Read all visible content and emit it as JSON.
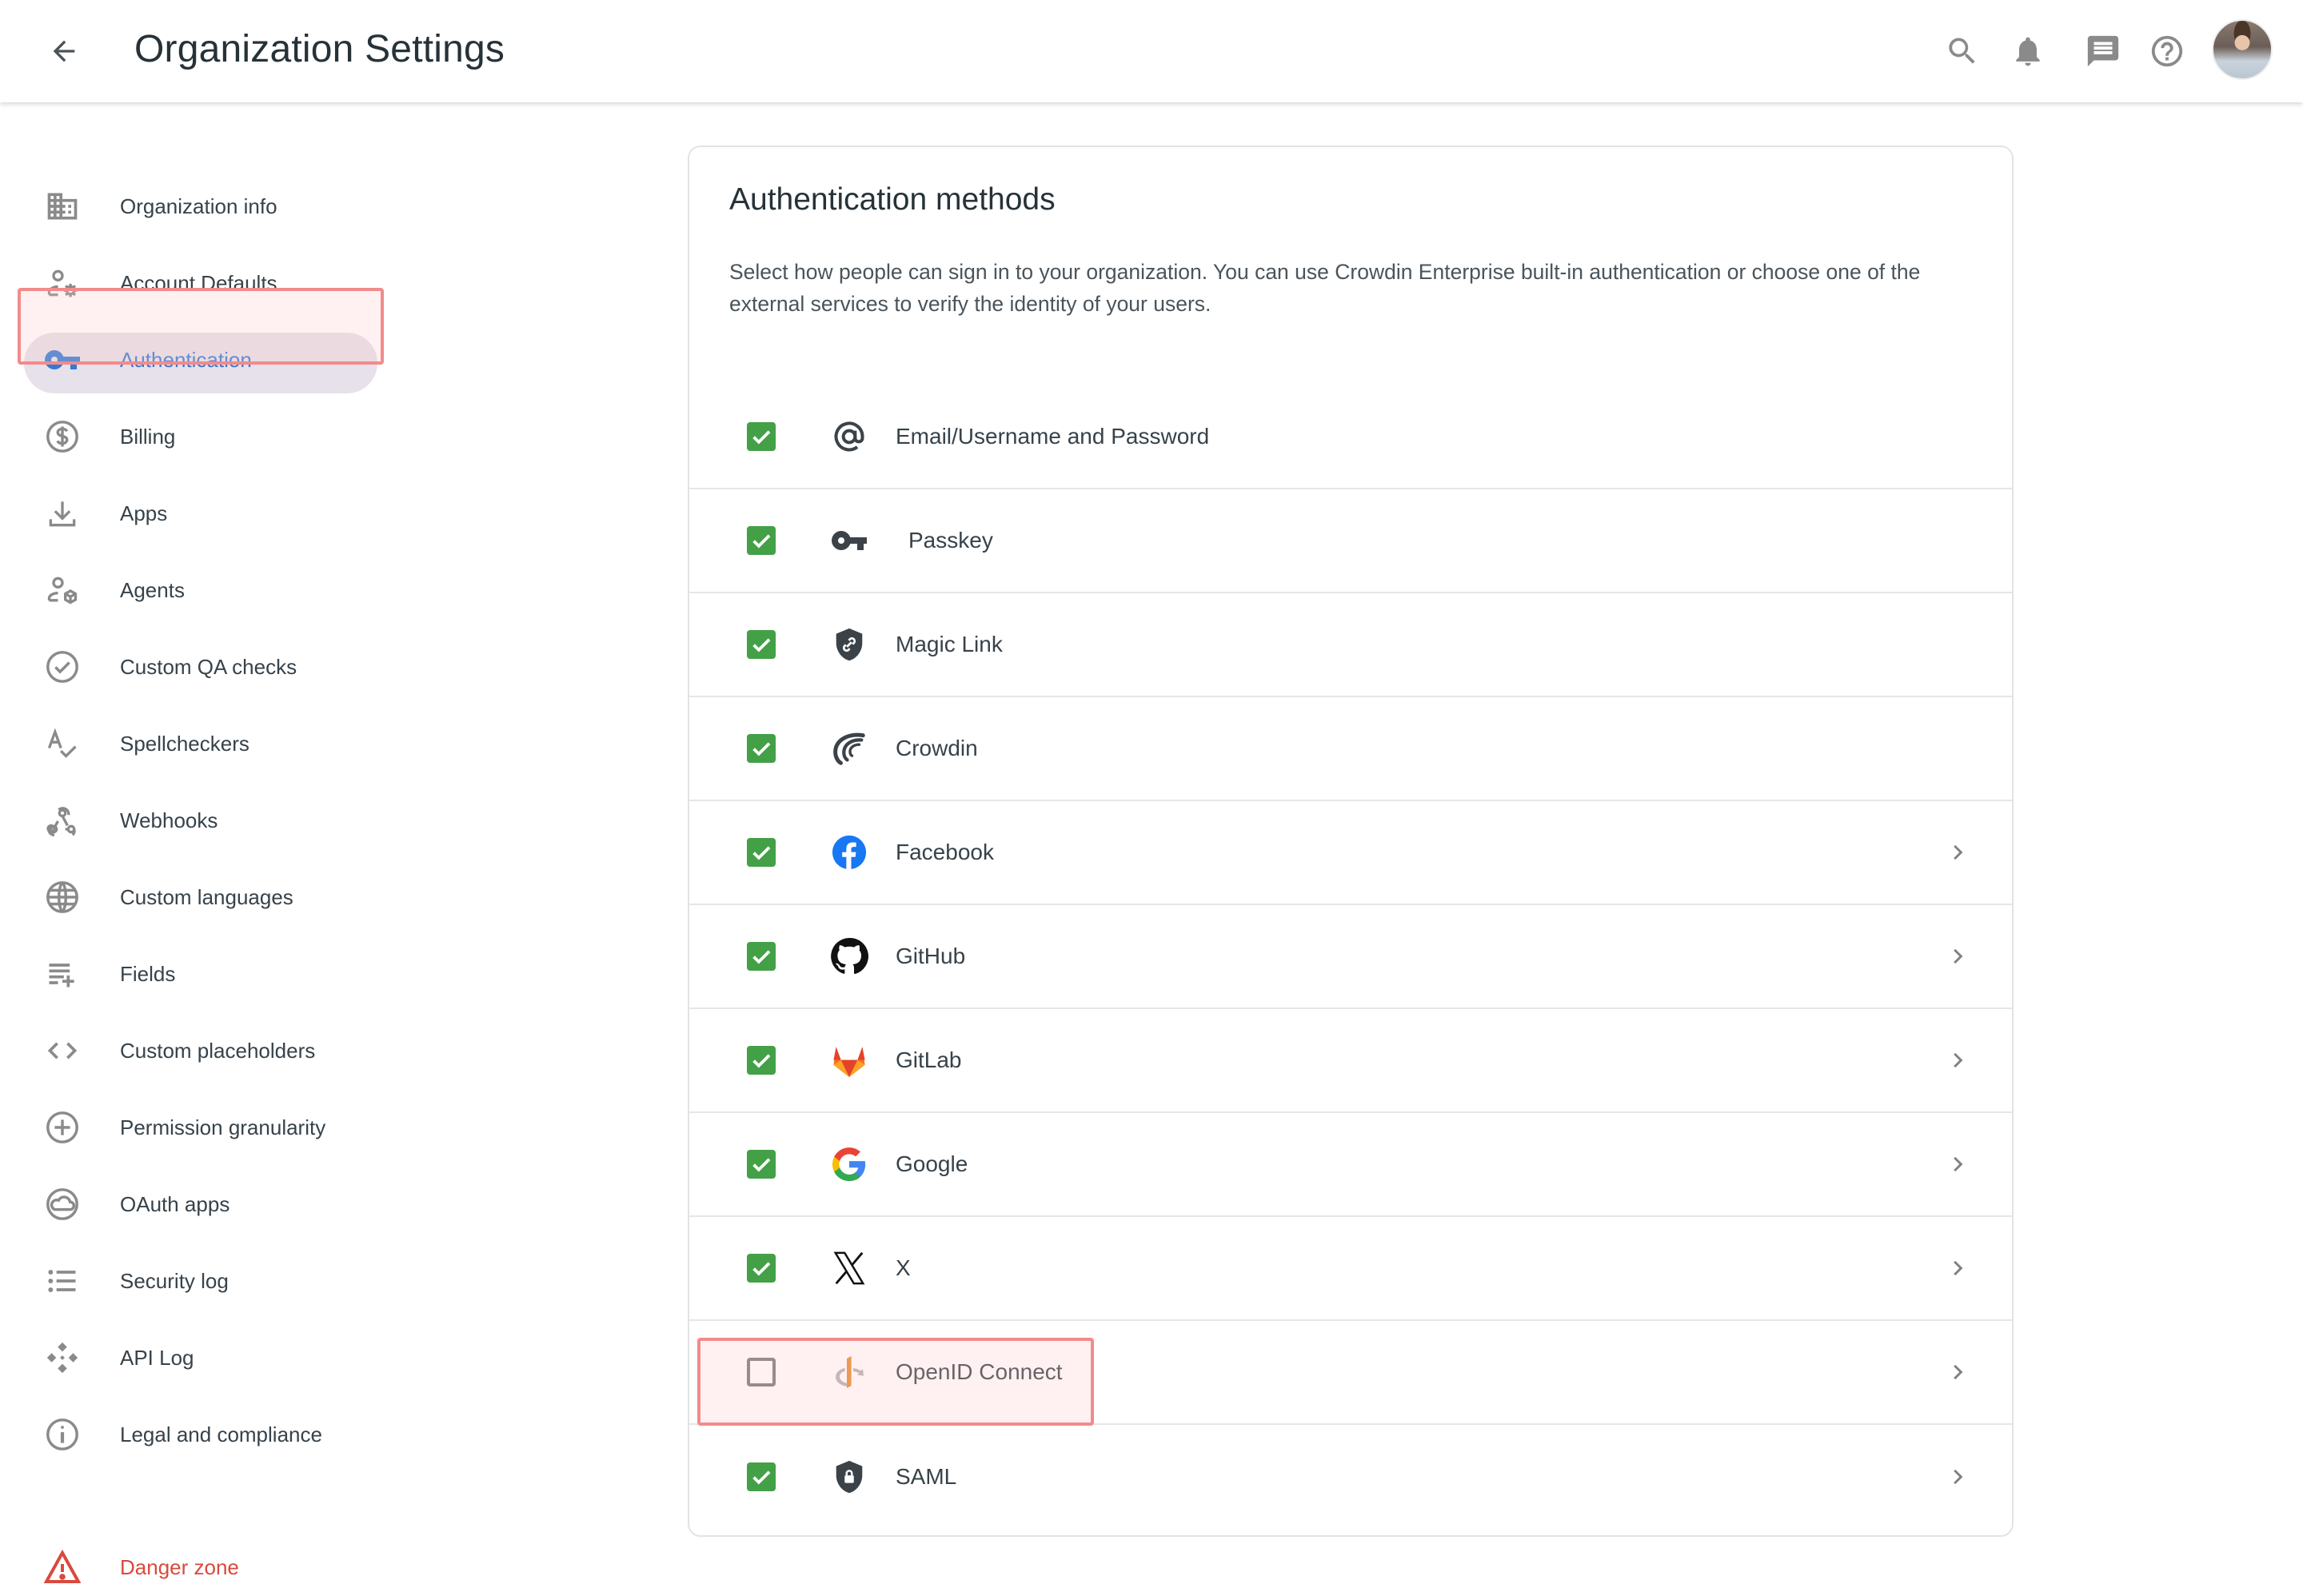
{
  "header": {
    "title": "Organization Settings",
    "back_icon": "arrow-left-icon",
    "actions": [
      {
        "name": "search",
        "icon": "search-icon"
      },
      {
        "name": "notifications",
        "icon": "bell-icon"
      },
      {
        "name": "messages",
        "icon": "chat-icon"
      },
      {
        "name": "help",
        "icon": "help-circle-icon"
      },
      {
        "name": "profile",
        "icon": "avatar"
      }
    ]
  },
  "sidebar": {
    "items": [
      {
        "label": "Organization info",
        "icon": "building-icon"
      },
      {
        "label": "Account Defaults",
        "icon": "user-gear-icon"
      },
      {
        "label": "Authentication",
        "icon": "key-icon",
        "active": true
      },
      {
        "label": "Billing",
        "icon": "dollar-circle-icon"
      },
      {
        "label": "Apps",
        "icon": "download-icon"
      },
      {
        "label": "Agents",
        "icon": "user-cube-icon"
      },
      {
        "label": "Custom QA checks",
        "icon": "check-circle-icon"
      },
      {
        "label": "Spellcheckers",
        "icon": "spellcheck-icon"
      },
      {
        "label": "Webhooks",
        "icon": "webhook-icon"
      },
      {
        "label": "Custom languages",
        "icon": "globe-icon"
      },
      {
        "label": "Fields",
        "icon": "playlist-add-icon"
      },
      {
        "label": "Custom placeholders",
        "icon": "code-icon"
      },
      {
        "label": "Permission granularity",
        "icon": "plus-circle-icon"
      },
      {
        "label": "OAuth apps",
        "icon": "cloud-circle-icon"
      },
      {
        "label": "Security log",
        "icon": "list-icon"
      },
      {
        "label": "API Log",
        "icon": "api-icon"
      },
      {
        "label": "Legal and compliance",
        "icon": "info-icon"
      }
    ],
    "danger": {
      "label": "Danger zone",
      "icon": "warning-icon"
    }
  },
  "card": {
    "title": "Authentication methods",
    "description": "Select how people can sign in to your organization. You can use Crowdin Enterprise built-in authentication or choose one of the external services to verify the identity of your users.",
    "methods": [
      {
        "label": "Email/Username and Password",
        "icon": "at-sign-icon",
        "checked": true,
        "has_chevron": false
      },
      {
        "label": "Passkey",
        "icon": "key-icon",
        "checked": true,
        "has_chevron": false
      },
      {
        "label": "Magic Link",
        "icon": "shield-link-icon",
        "checked": true,
        "has_chevron": false
      },
      {
        "label": "Crowdin",
        "icon": "crowdin-icon",
        "checked": true,
        "has_chevron": false
      },
      {
        "label": "Facebook",
        "icon": "facebook-icon",
        "checked": true,
        "has_chevron": true
      },
      {
        "label": "GitHub",
        "icon": "github-icon",
        "checked": true,
        "has_chevron": true
      },
      {
        "label": "GitLab",
        "icon": "gitlab-icon",
        "checked": true,
        "has_chevron": true
      },
      {
        "label": "Google",
        "icon": "google-icon",
        "checked": true,
        "has_chevron": true
      },
      {
        "label": "X",
        "icon": "x-icon",
        "checked": true,
        "has_chevron": true
      },
      {
        "label": "OpenID Connect",
        "icon": "openid-icon",
        "checked": false,
        "has_chevron": true,
        "highlighted": true
      },
      {
        "label": "SAML",
        "icon": "shield-lock-icon",
        "checked": true,
        "has_chevron": true
      }
    ]
  },
  "colors": {
    "accent": "#2f7bd3",
    "checkbox_on": "#43a047",
    "danger": "#d94a3d",
    "highlight_border": "#f28b8b",
    "active_pill": "#e6e1ea"
  }
}
